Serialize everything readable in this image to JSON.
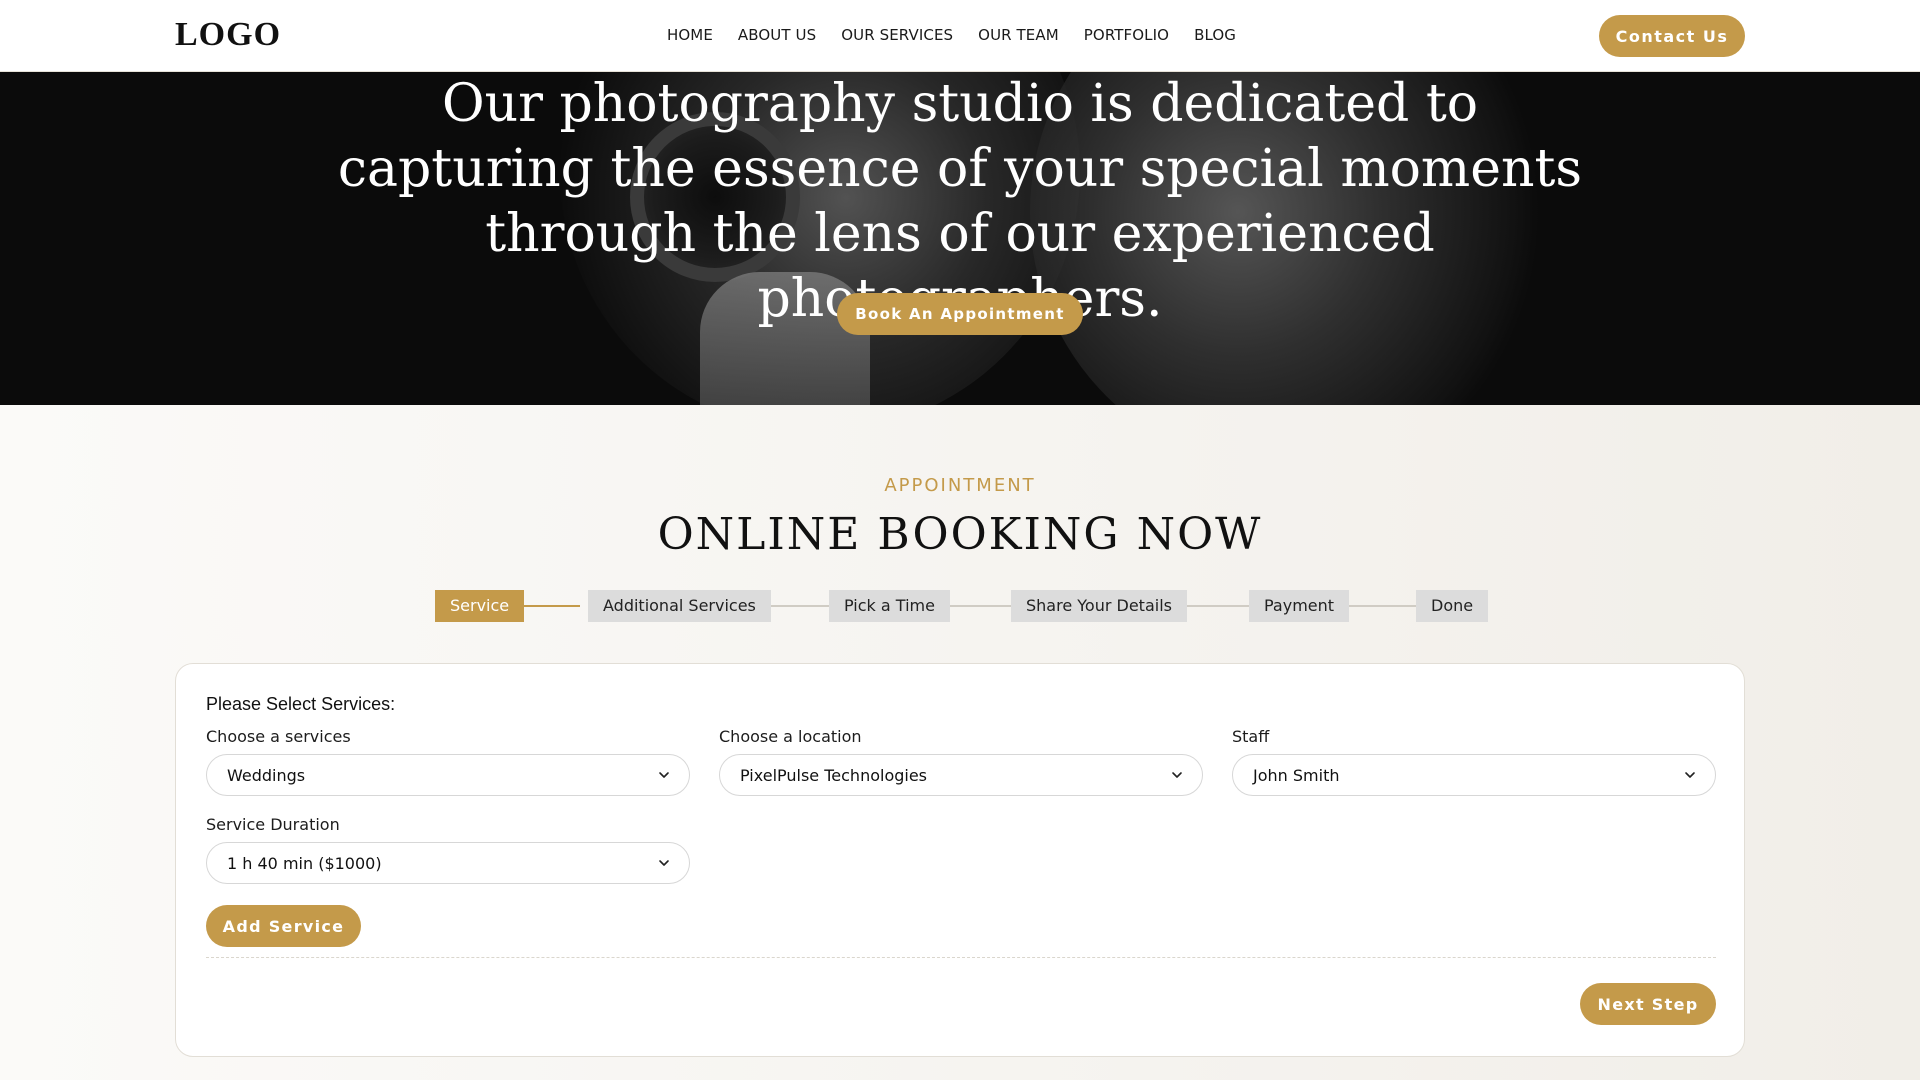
{
  "nav": {
    "logo": "LOGO",
    "links": [
      "HOME",
      "ABOUT US",
      "OUR SERVICES",
      "OUR TEAM",
      "PORTFOLIO",
      "BLOG"
    ],
    "contact_label": "Contact Us"
  },
  "hero": {
    "title": "Our photography studio is dedicated to capturing the essence of your special moments through the lens of our experienced photographers.",
    "book_label": "Book An Appointment"
  },
  "booking": {
    "eyebrow": "APPOINTMENT",
    "title": "ONLINE BOOKING NOW",
    "steps": [
      "Service",
      "Additional Services",
      "Pick a Time",
      "Share Your Details",
      "Payment",
      "Done"
    ],
    "active_step": "Service",
    "form": {
      "heading": "Please Select Services:",
      "service_label": "Choose a services",
      "service_value": "Weddings",
      "location_label": "Choose a location",
      "location_value": "PixelPulse Technologies",
      "staff_label": "Staff",
      "staff_value": "John Smith",
      "duration_label": "Service Duration",
      "duration_value": "1 h 40 min ($1000)",
      "add_service_label": "Add Service",
      "next_label": "Next Step"
    }
  },
  "colors": {
    "accent": "#c49a4a",
    "hero_bg": "#0b0b0b",
    "step_inactive": "#dcdcdc"
  },
  "icons": {
    "select_arrow": "chevron-down-icon"
  }
}
